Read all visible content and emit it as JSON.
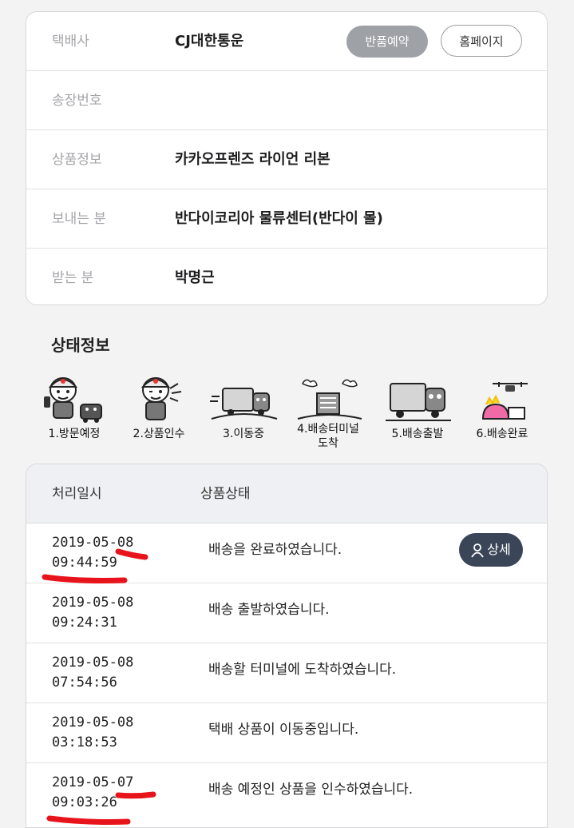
{
  "info": {
    "courier_label": "택배사",
    "courier_value": "CJ대한통운",
    "return_button": "반품예약",
    "homepage_button": "홈페이지",
    "invoice_label": "송장번호",
    "invoice_value": "",
    "product_label": "상품정보",
    "product_value": "카카오프렌즈 라이언 리본",
    "sender_label": "보내는 분",
    "sender_value": "반다이코리아 물류센터(반다이 몰)",
    "receiver_label": "받는 분",
    "receiver_value": "박명근"
  },
  "status": {
    "title": "상태정보",
    "steps": [
      {
        "label": "1.방문예정",
        "icon": "courier-phone-icon"
      },
      {
        "label": "2.상품인수",
        "icon": "courier-pickup-icon"
      },
      {
        "label": "3.이동중",
        "icon": "truck-moving-icon"
      },
      {
        "label_line1": "4.배송터미널",
        "label_line2": "도착",
        "icon": "terminal-building-icon"
      },
      {
        "label": "5.배송출발",
        "icon": "truck-departure-icon"
      },
      {
        "label": "6.배송완료",
        "icon": "drone-delivery-icon"
      }
    ]
  },
  "tracking": {
    "header_date": "처리일시",
    "header_status": "상품상태",
    "detail_button": "상세",
    "rows": [
      {
        "date": "2019-05-08",
        "time": "09:44:59",
        "status": "배송을 완료하였습니다."
      },
      {
        "date": "2019-05-08",
        "time": "09:24:31",
        "status": "배송 출발하였습니다."
      },
      {
        "date": "2019-05-08",
        "time": "07:54:56",
        "status": "배송할 터미널에 도착하였습니다."
      },
      {
        "date": "2019-05-08",
        "time": "03:18:53",
        "status": "택배 상품이 이동중입니다."
      },
      {
        "date": "2019-05-07",
        "time": "09:03:26",
        "status": "배송 예정인 상품을 인수하였습니다."
      }
    ]
  },
  "colors": {
    "return_button_bg": "#9ea1a6",
    "detail_button_bg": "#3a4557",
    "annotation_red": "#e8141b"
  }
}
